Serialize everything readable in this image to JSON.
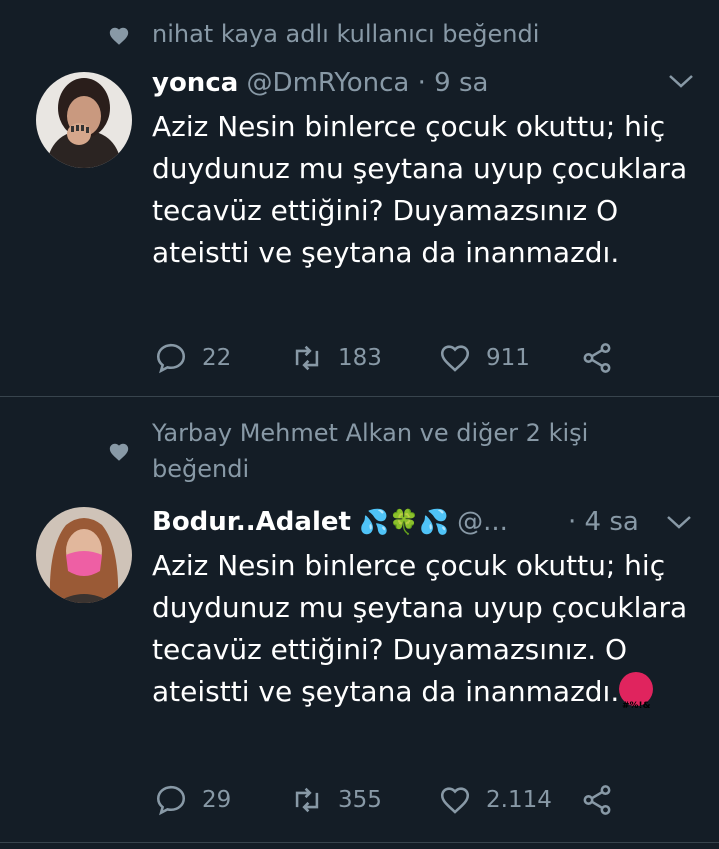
{
  "tweets": [
    {
      "social_context": "nihat kaya adlı kullanıcı beğendi",
      "name": "yonca",
      "handle": "@DmRYonca",
      "separator": "·",
      "time": "9 sa",
      "text": "Aziz Nesin binlerce çocuk okuttu; hiç duydunuz mu şeytana uyup çocuklara tecavüz ettiğini? Duyamazsınız O ateistti ve şeytana da inanmazdı.",
      "replies": "22",
      "retweets": "183",
      "likes": "911"
    },
    {
      "social_context": "Yarbay Mehmet Alkan ve diğer 2 kişi beğendi",
      "name": "Bodur..Adalet",
      "name_emojis": "💦🍀💦",
      "handle": "@...",
      "separator": "·",
      "time": "4 sa",
      "text": "Aziz Nesin binlerce çocuk okuttu; hiç duydunuz mu şeytana uyup çocuklara tecavüz ettiğini? Duyamazsınız. O ateistti ve şeytana da inanmazdı.",
      "angry_emoji_text": "#%!&",
      "replies": "29",
      "retweets": "355",
      "likes": "2.114"
    }
  ],
  "icons": {
    "social_like": "heart-icon",
    "more": "chevron-down-icon",
    "reply": "reply-icon",
    "retweet": "retweet-icon",
    "like": "like-icon",
    "share": "share-icon"
  },
  "colors": {
    "background": "#141d26",
    "text_primary": "#ffffff",
    "text_secondary": "#8899a6",
    "divider": "#38444d"
  }
}
